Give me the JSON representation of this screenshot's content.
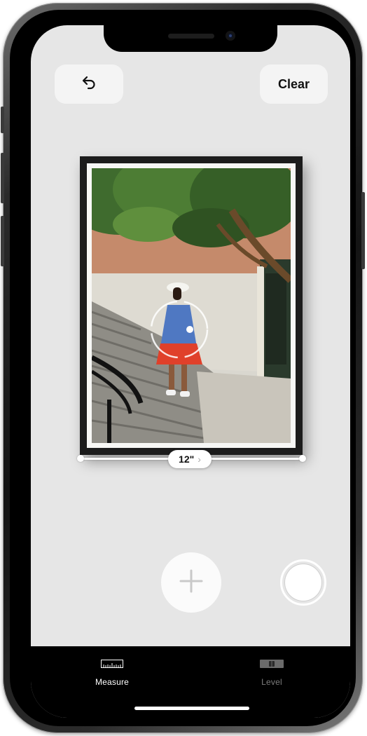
{
  "app": {
    "name": "Measure"
  },
  "toolbar": {
    "undo_icon": "undo-arrow-icon",
    "clear_label": "Clear"
  },
  "measurement": {
    "value_label": "12\"",
    "detail_icon": "chevron-right-icon"
  },
  "controls": {
    "add_point_icon": "plus-icon",
    "capture_icon": "shutter-icon"
  },
  "tabs": [
    {
      "label": "Measure",
      "icon": "ruler-icon",
      "selected": true
    },
    {
      "label": "Level",
      "icon": "level-icon",
      "selected": false
    }
  ],
  "colors": {
    "screen_background": "#e6e6e6",
    "tab_active": "#ffffff",
    "tab_inactive": "#7c7c7c"
  }
}
